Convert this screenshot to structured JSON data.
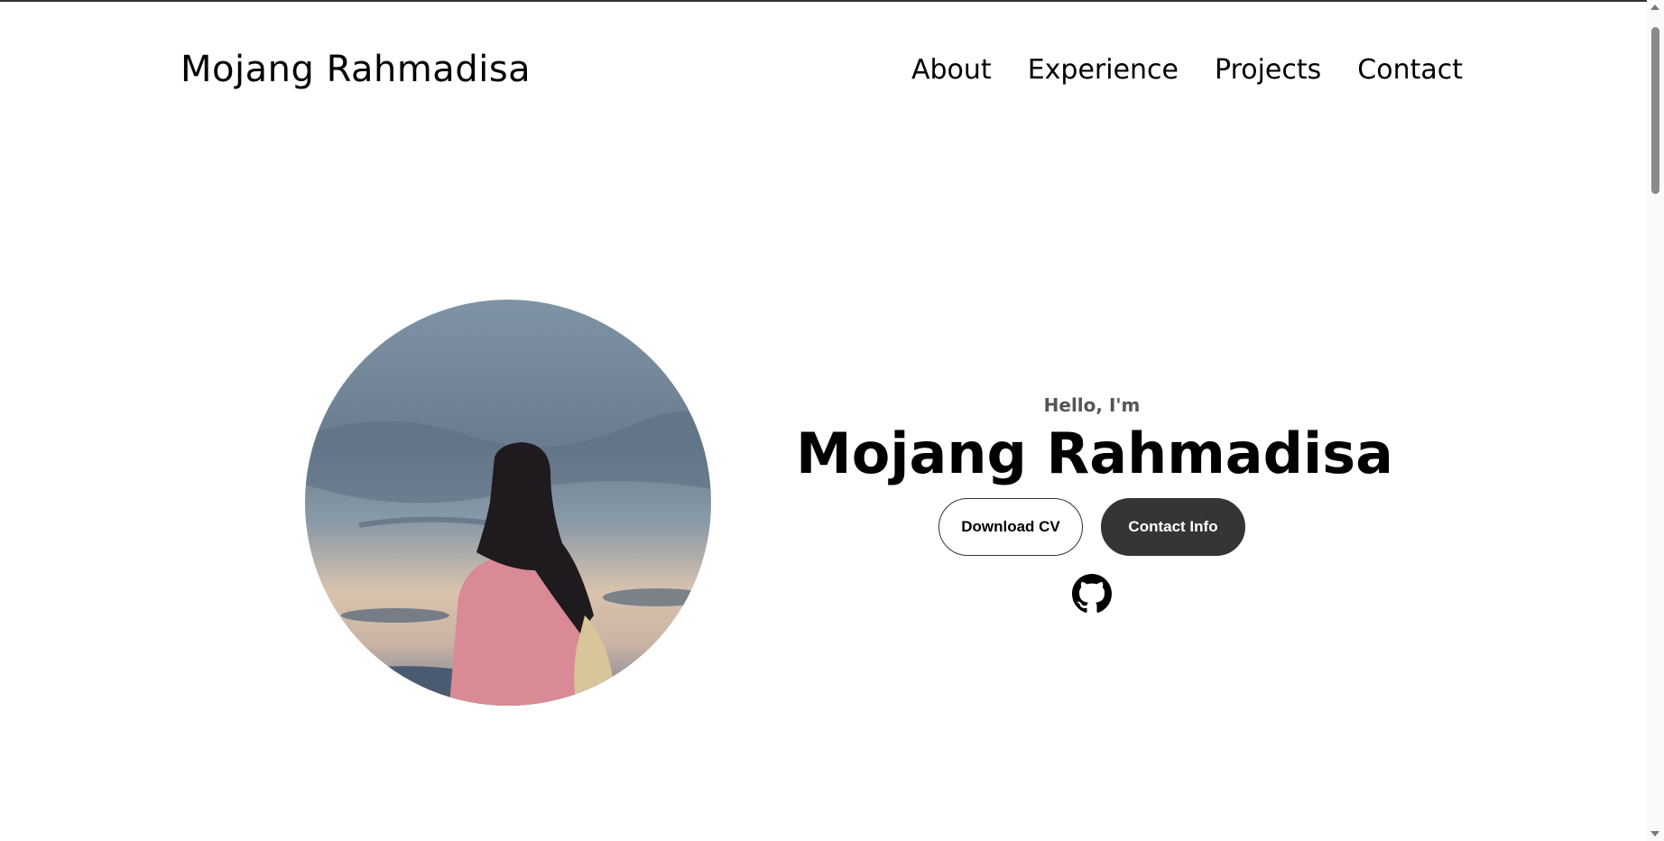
{
  "nav": {
    "logo": "Mojang Rahmadisa",
    "links": [
      {
        "label": "About"
      },
      {
        "label": "Experience"
      },
      {
        "label": "Projects"
      },
      {
        "label": "Contact"
      }
    ]
  },
  "hero": {
    "greeting": "Hello, I'm",
    "name": "Mojang Rahmadisa",
    "download_cv_label": "Download CV",
    "contact_info_label": "Contact Info",
    "social_icon": "github-icon"
  },
  "colors": {
    "text": "#000000",
    "muted": "#555555",
    "button_dark": "#353535",
    "background": "#ffffff"
  }
}
